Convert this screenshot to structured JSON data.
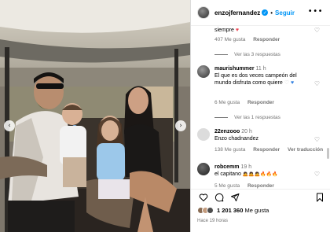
{
  "post": {
    "author": "enzojfernandez",
    "follow_label": "Seguir",
    "dot": "•",
    "more": "•••"
  },
  "photo": {
    "prev_arrow": "‹",
    "next_arrow": "›"
  },
  "comments": [
    {
      "text_tail": "siempre",
      "likes": "407 Me gusta",
      "reply_label": "Responder",
      "view_replies": "Ver las 3 respuestas"
    },
    {
      "username": "maurishummer",
      "time": "11 h",
      "text": "El que es dos veces campeón del mundo disfruta como quiere",
      "likes": "6 Me gusta",
      "reply_label": "Responder",
      "view_replies": "Ver las 1 respuestas"
    },
    {
      "username": "22enzooo",
      "time": "20 h",
      "text": "Enzo chadnandez",
      "likes": "138 Me gusta",
      "reply_label": "Responder",
      "translate_label": "Ver traducción"
    },
    {
      "username": "robcemm",
      "time": "19 h",
      "text": "el capitano",
      "emoji_text": "🙇🙇🙇🔥🔥🔥",
      "likes": "5 Me gusta",
      "reply_label": "Responder"
    }
  ],
  "actions": {
    "like_count": "1 201 360",
    "likes_suffix": "Me gusta",
    "timestamp": "Hace 19 horas"
  },
  "icons": {
    "verified": "verified-badge-icon",
    "heart": "heart-icon",
    "comment": "comment-icon",
    "share": "share-icon",
    "save": "bookmark-icon"
  },
  "colors": {
    "accent": "#0095f6",
    "muted": "#737373",
    "heart_red": "#ed4956"
  }
}
